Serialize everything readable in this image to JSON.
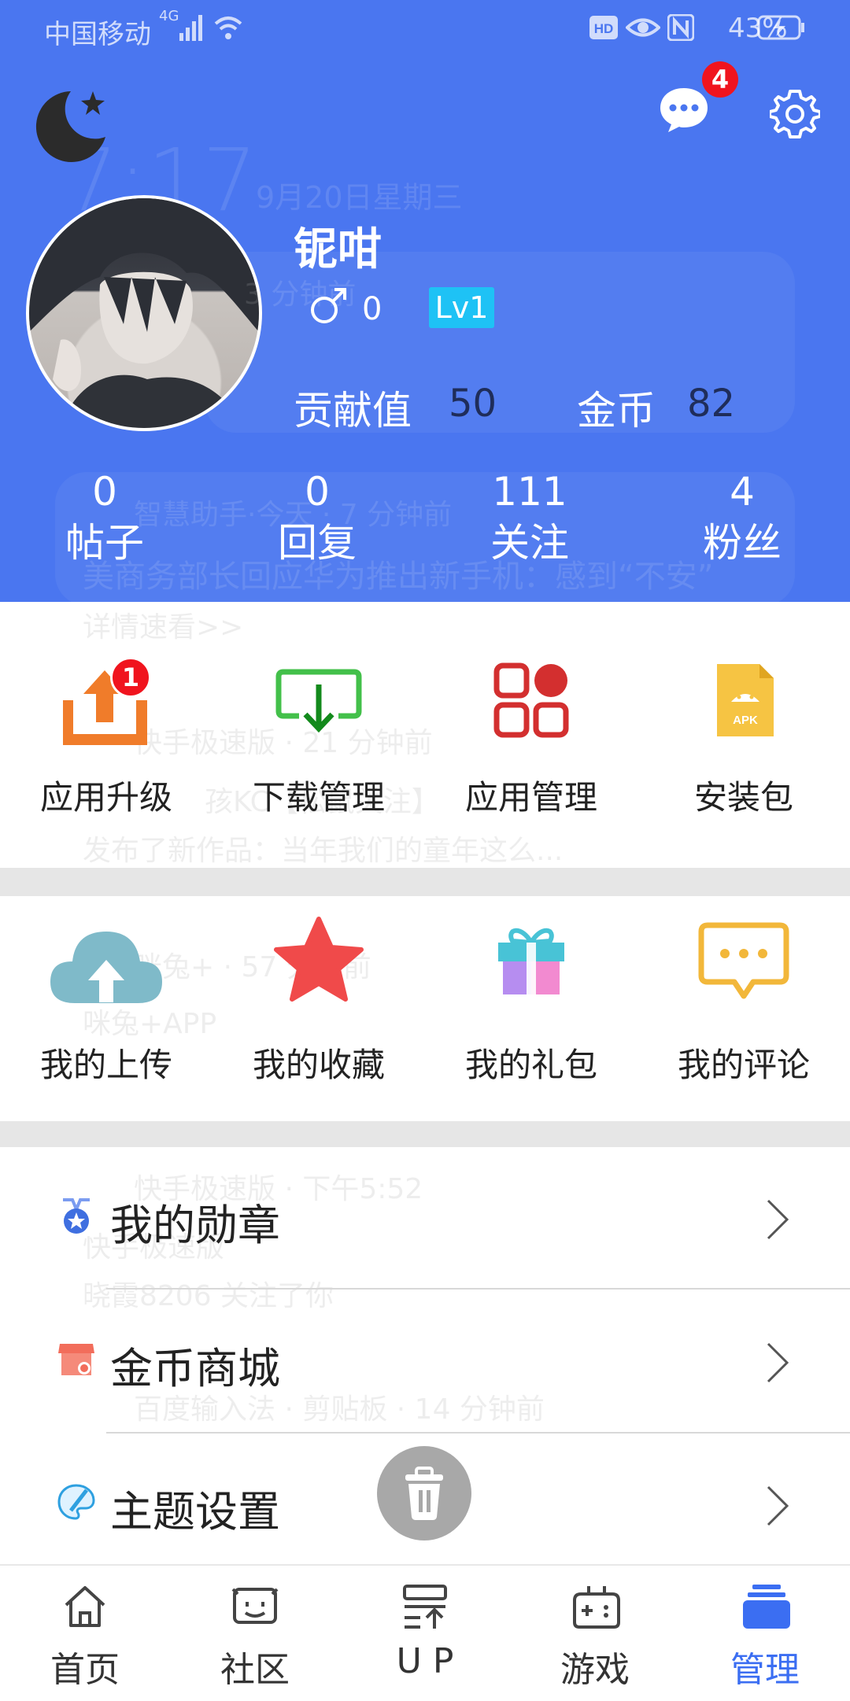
{
  "status_bar": {
    "carrier": "中国移动",
    "network": "4G",
    "battery": "43%"
  },
  "lockscreen_overlay": {
    "time": "7:17",
    "date": "9月20日星期三",
    "notifications": [
      "3 分钟前",
      "智慧助手·今天 · 7 分钟前",
      "美商务部长回应华为推出新手机：感到“不安”",
      "详情速看>>",
      "快手极速版 · 21 分钟前",
      "孩KC【松鼠关注】",
      "发布了新作品：当年我们的童年这么...",
      "咪兔+ · 57 分钟前",
      "咪兔+APP",
      "快手极速版 · 下午5:52",
      "快手极速版",
      "晓霞8206 关注了你",
      "百度输入法 · 剪贴板 · 14 分钟前"
    ]
  },
  "header": {
    "message_badge": "4",
    "profile": {
      "username": "铌咁",
      "gender_symbol": "♂",
      "gender_count": "0",
      "level": "Lv1",
      "contribution_label": "贡献值",
      "contribution_value": "50",
      "coin_label": "金币",
      "coin_value": "82"
    },
    "stats": [
      {
        "value": "0",
        "label": "帖子"
      },
      {
        "value": "0",
        "label": "回复"
      },
      {
        "value": "111",
        "label": "关注"
      },
      {
        "value": "4",
        "label": "粉丝"
      }
    ]
  },
  "app_tools": [
    {
      "label": "应用升级",
      "icon": "upload-box-icon",
      "badge": "1"
    },
    {
      "label": "下载管理",
      "icon": "download-box-icon"
    },
    {
      "label": "应用管理",
      "icon": "app-grid-icon"
    },
    {
      "label": "安装包",
      "icon": "apk-file-icon"
    }
  ],
  "my_items": [
    {
      "label": "我的上传",
      "icon": "cloud-upload-icon"
    },
    {
      "label": "我的收藏",
      "icon": "star-icon"
    },
    {
      "label": "我的礼包",
      "icon": "gift-icon"
    },
    {
      "label": "我的评论",
      "icon": "comment-icon"
    }
  ],
  "menu_list": [
    {
      "label": "我的勋章",
      "icon": "medal-icon"
    },
    {
      "label": "金币商城",
      "icon": "shop-icon"
    },
    {
      "label": "主题设置",
      "icon": "palette-icon"
    }
  ],
  "bottom_nav": [
    {
      "label": "首页",
      "icon": "home-icon"
    },
    {
      "label": "社区",
      "icon": "community-icon"
    },
    {
      "label": "U P",
      "icon": "up-icon"
    },
    {
      "label": "游戏",
      "icon": "gamepad-icon"
    },
    {
      "label": "管理",
      "icon": "manage-icon",
      "active": true
    }
  ],
  "colors": {
    "header_bg": "#4a76f0",
    "accent": "#3b6ef2",
    "badge_red": "#f0141e",
    "level_badge": "#1ec2f5"
  }
}
